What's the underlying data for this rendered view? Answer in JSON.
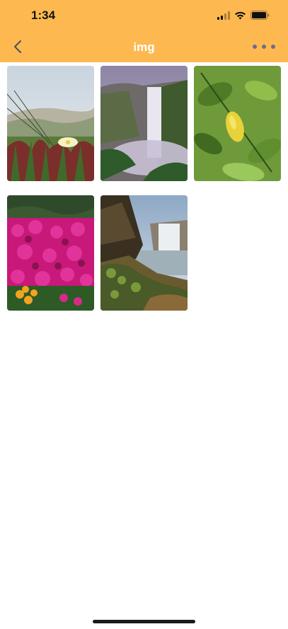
{
  "status_bar": {
    "time": "1:34",
    "icons": [
      "signal-icon",
      "wifi-icon",
      "battery-icon"
    ]
  },
  "nav": {
    "title": "img",
    "back_icon": "chevron-left-icon",
    "more_icon": "more-horizontal-icon"
  },
  "colors": {
    "header_bg": "#FDB950",
    "title": "#FFFFFF",
    "more_dots": "#6A6F84",
    "background": "#FFFFFF"
  },
  "photos": [
    {
      "subject": "ice-plant-flower-grass"
    },
    {
      "subject": "waterfall-cliff-mist"
    },
    {
      "subject": "lemon-leaves"
    },
    {
      "subject": "magenta-flower-field"
    },
    {
      "subject": "waterfall-rocky-shore"
    }
  ]
}
